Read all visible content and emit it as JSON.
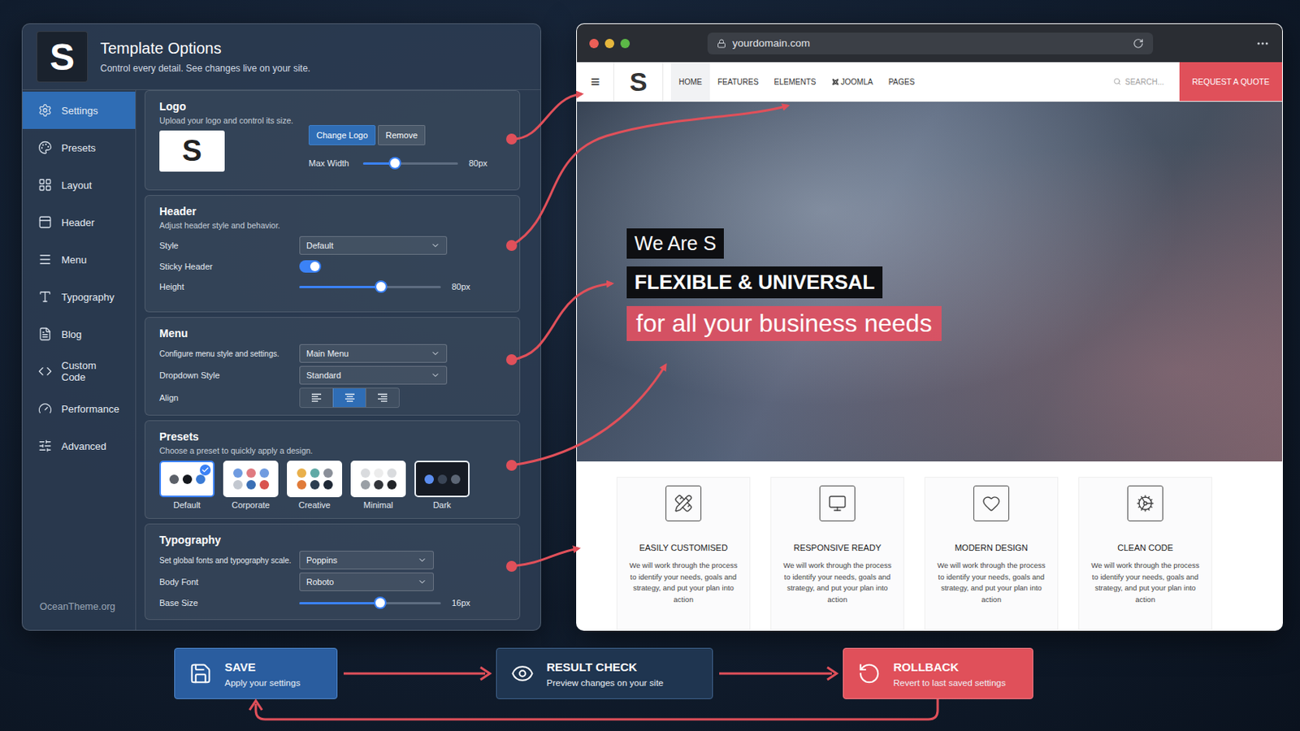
{
  "panel": {
    "logo": "S",
    "title": "Template Options",
    "subtitle": "Control every detail. See changes live on your site.",
    "footer": "OceanTheme.org"
  },
  "sidebar": {
    "items": [
      {
        "label": "Settings",
        "selected": true
      },
      {
        "label": "Presets",
        "selected": false
      },
      {
        "label": "Layout",
        "selected": false
      },
      {
        "label": "Header",
        "selected": false
      },
      {
        "label": "Menu",
        "selected": false
      },
      {
        "label": "Typography",
        "selected": false
      },
      {
        "label": "Blog",
        "selected": false
      },
      {
        "label": "Custom Code",
        "selected": false
      },
      {
        "label": "Performance",
        "selected": false
      },
      {
        "label": "Advanced",
        "selected": false
      }
    ]
  },
  "sections": [
    {
      "kind": "logo",
      "title": "Logo",
      "description": "Upload your logo and control its size.",
      "preview": "S",
      "buttons": [
        {
          "label": "Change Logo",
          "primary": true
        },
        {
          "label": "Remove",
          "primary": false
        }
      ],
      "slider": {
        "label": "Max Width",
        "level": 0.34,
        "reading": "80px"
      }
    },
    {
      "kind": "rows",
      "title": "Header",
      "description": "Adjust header style and behavior.",
      "rows": [
        {
          "kind": "select",
          "label": "Style",
          "value": "Default"
        },
        {
          "kind": "toggle",
          "label": "Sticky Header",
          "on": true
        },
        {
          "kind": "slider",
          "label": "Height",
          "level": 0.575,
          "reading": "80px"
        }
      ]
    },
    {
      "kind": "rows",
      "title": "Menu",
      "description": "",
      "rows": [
        {
          "kind": "select",
          "label": "Configure menu style and settings.",
          "value": "Main Menu"
        },
        {
          "kind": "select",
          "label": "Dropdown Style",
          "value": "Standard"
        },
        {
          "kind": "align",
          "label": "Align",
          "options": [
            {
              "selected": false
            },
            {
              "selected": true
            },
            {
              "selected": false
            }
          ]
        }
      ]
    },
    {
      "kind": "presets",
      "title": "Presets",
      "description": "Choose a preset to quickly apply a design.",
      "presets": [
        {
          "label": "Default",
          "selected": true,
          "dark": false,
          "colors": [
            "#5b6068",
            "#15181d",
            "#3a7bd5"
          ]
        },
        {
          "label": "Corporate",
          "selected": false,
          "dark": false,
          "colors": [
            "#6f9be0",
            "#e07a80",
            "#6f9be0",
            "#c3c8d0",
            "#3a6fb5",
            "#d9534f"
          ]
        },
        {
          "label": "Creative",
          "selected": false,
          "dark": false,
          "colors": [
            "#e9b04b",
            "#5fa9a5",
            "#8a8f99",
            "#e07b39",
            "#2c3e50",
            "#1f2937"
          ]
        },
        {
          "label": "Minimal",
          "selected": false,
          "dark": false,
          "colors": [
            "#d9dbde",
            "#ececec",
            "#d9dbde",
            "#9aa0a6",
            "#33363b",
            "#222428"
          ]
        },
        {
          "label": "Dark",
          "selected": false,
          "dark": true,
          "colors": [
            "#5b8def",
            "#3a4556",
            "#5c6675"
          ]
        }
      ]
    },
    {
      "kind": "rows",
      "title": "Typography",
      "description": "",
      "rows": [
        {
          "kind": "select",
          "label": "Set global fonts and typography scale.",
          "value": "Poppins"
        },
        {
          "kind": "select",
          "label": "Body Font",
          "value": "Roboto"
        },
        {
          "kind": "slider",
          "label": "Base Size",
          "level": 0.57,
          "reading": "16px"
        }
      ]
    }
  ],
  "browser": {
    "url": "yourdomain.com",
    "menu": "≡",
    "logo": "S",
    "nav": [
      {
        "label": "HOME",
        "selected": true,
        "kind": "text"
      },
      {
        "label": "FEATURES",
        "selected": false,
        "kind": "text"
      },
      {
        "label": "ELEMENTS",
        "selected": false,
        "kind": "text"
      },
      {
        "label": "JOOMLA",
        "selected": false,
        "kind": "brand"
      },
      {
        "label": "PAGES",
        "selected": false,
        "kind": "text"
      }
    ],
    "search": "SEARCH...",
    "cta": "REQUEST A QUOTE",
    "hero": [
      {
        "text": "We Are S",
        "kind": "label"
      },
      {
        "text": "FLEXIBLE & UNIVERSAL",
        "kind": "headline"
      },
      {
        "text": "for all your business needs",
        "kind": "accent"
      }
    ],
    "features": [
      {
        "title": "EASILY CUSTOMISED",
        "text": "We will work through the process to identify your needs, goals and strategy, and put your plan into action"
      },
      {
        "title": "RESPONSIVE READY",
        "text": "We will work through the process to identify your needs, goals and strategy, and put your plan into action"
      },
      {
        "title": "MODERN DESIGN",
        "text": "We will work through the process to identify your needs, goals and strategy, and put your plan into action"
      },
      {
        "title": "CLEAN CODE",
        "text": "We will work through the process to identify your needs, goals and strategy, and put your plan into action"
      }
    ]
  },
  "flow": {
    "steps": [
      {
        "title": "SAVE",
        "subtitle": "Apply your settings",
        "kind": "primary"
      },
      {
        "title": "RESULT CHECK",
        "subtitle": "Preview changes on your site",
        "kind": "secondary"
      },
      {
        "title": "ROLLBACK",
        "subtitle": "Revert to last saved settings",
        "kind": "danger"
      }
    ]
  }
}
